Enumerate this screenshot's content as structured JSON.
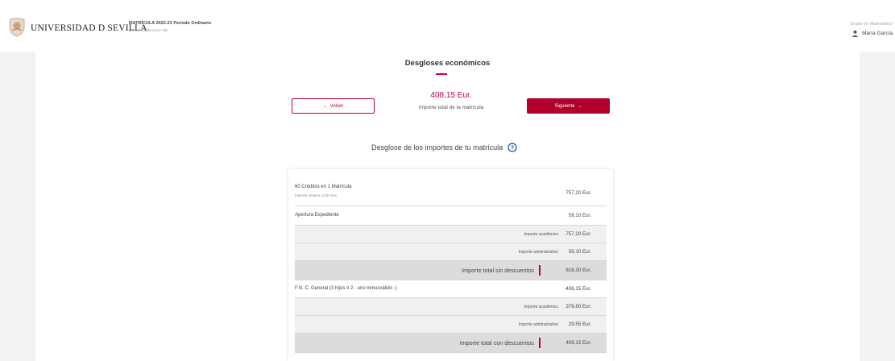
{
  "header": {
    "university_name": "UNIVERSIDAD D SEVILLA",
    "matricula_title": "MATRÍCULA 2022-23 Periodo Ordinario",
    "last_modified": "Última modificación: 5/8",
    "degree": "Grado en Matemático",
    "user_name": "María García"
  },
  "page": {
    "title": "Desgloses económicos",
    "total_amount": "408,15 Eur.",
    "total_label": "Importe total de la matrícula",
    "back_button": "Volver",
    "next_button": "Siguiente",
    "subtitle": "Desglose de los importes de tu matrícula"
  },
  "breakdown": {
    "row1_label": "60 Créditos en 1 Matrícula",
    "row1_unit": "Importe unitario 12,62 Eur.",
    "row1_amount": "757,20 Eur.",
    "row2_label": "Apertura Expediente",
    "row2_amount": "59,10 Eur.",
    "row3_label": "Importe académico",
    "row3_amount": "757,20 Eur.",
    "row4_label": "Importe administrativo",
    "row4_amount": "59,10 Eur.",
    "row5_label": "Importe total sin descuentos",
    "row5_amount": "816,30 Eur.",
    "row6_label": "F.N. C. General (3 hijos ó 2 - uno minusválido -)",
    "row6_amount": "-408,15 Eur.",
    "row7_label": "Importe académico",
    "row7_amount": "378,60 Eur.",
    "row8_label": "Importe administrativo",
    "row8_amount": "29,55 Eur.",
    "row9_label": "Importe total con descuentos",
    "row9_amount": "408,15 Eur."
  },
  "colors": {
    "accent": "#c3002f",
    "button": "#b1002c",
    "subtotal_row": "#f0f0f0",
    "total_row": "#dcdcdc"
  },
  "icons": [
    "university-logo-icon",
    "user-icon",
    "arrow-left-icon",
    "arrow-right-icon",
    "help-icon"
  ]
}
